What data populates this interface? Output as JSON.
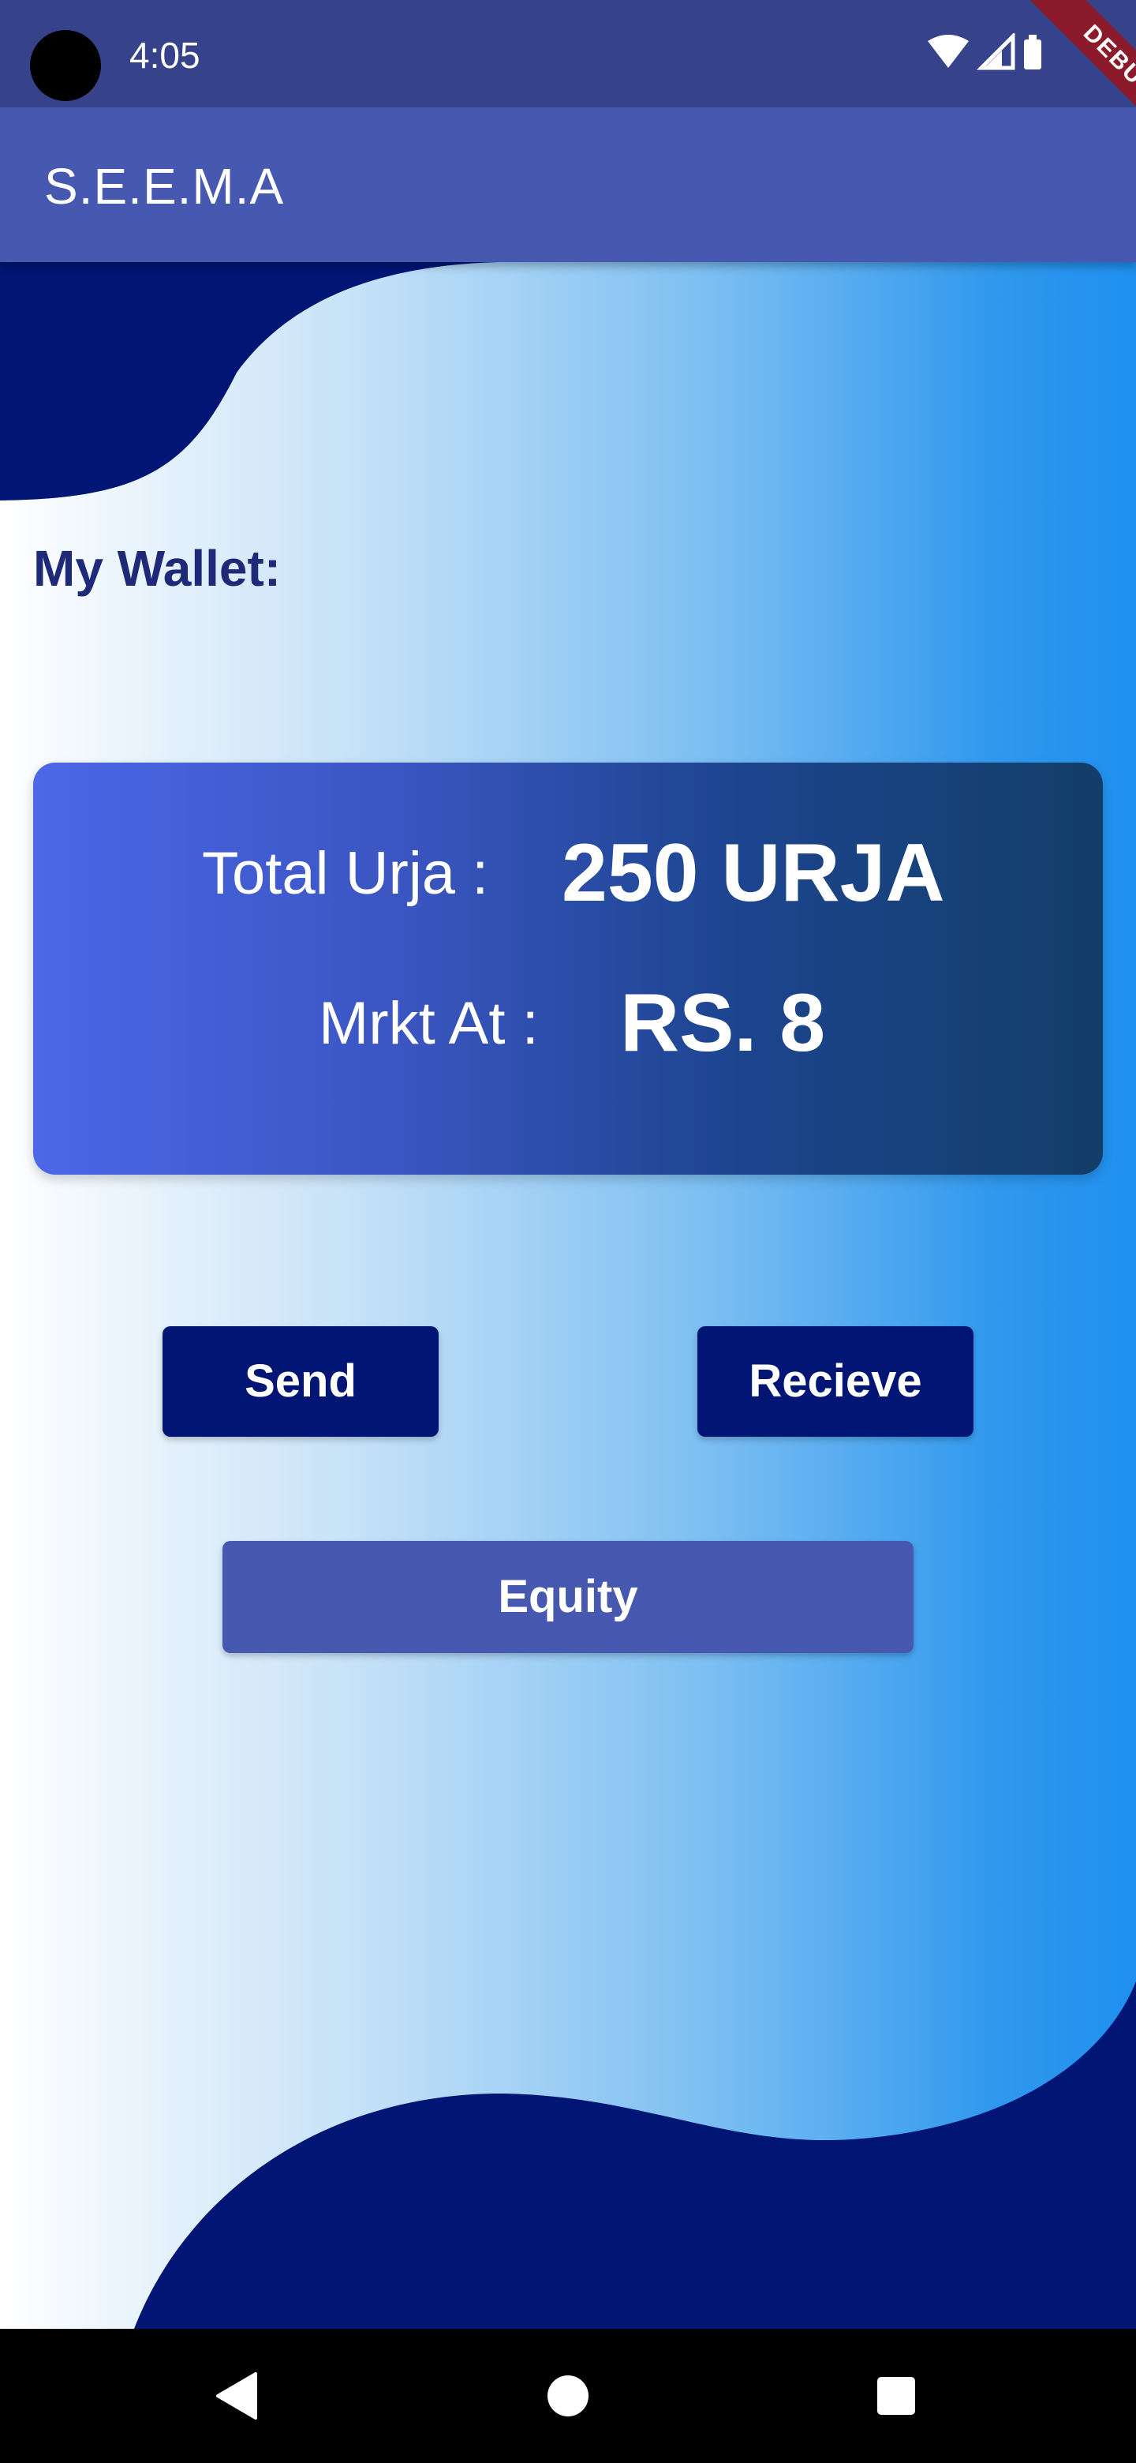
{
  "status_bar": {
    "time": "4:05",
    "icons": [
      "wifi-icon",
      "cellular-signal-icon",
      "battery-icon"
    ],
    "debug_banner": "DEBUG"
  },
  "app_bar": {
    "title": "S.E.E.M.A"
  },
  "wallet": {
    "heading": "My Wallet:",
    "total_label": "Total Urja :",
    "total_value": "250 URJA",
    "market_label": "Mrkt At :",
    "market_value": "RS. 8"
  },
  "actions": {
    "send_label": "Send",
    "receive_label": "Recieve",
    "equity_label": "Equity"
  },
  "nav_bar": {
    "icons": [
      "back-icon",
      "home-icon",
      "recents-icon"
    ]
  },
  "colors": {
    "status_bar": "#364289",
    "app_bar": "#4758b0",
    "wave": "#011575",
    "heading": "#1e2a78",
    "primary_button": "#011575",
    "secondary_button": "#4758b0"
  }
}
